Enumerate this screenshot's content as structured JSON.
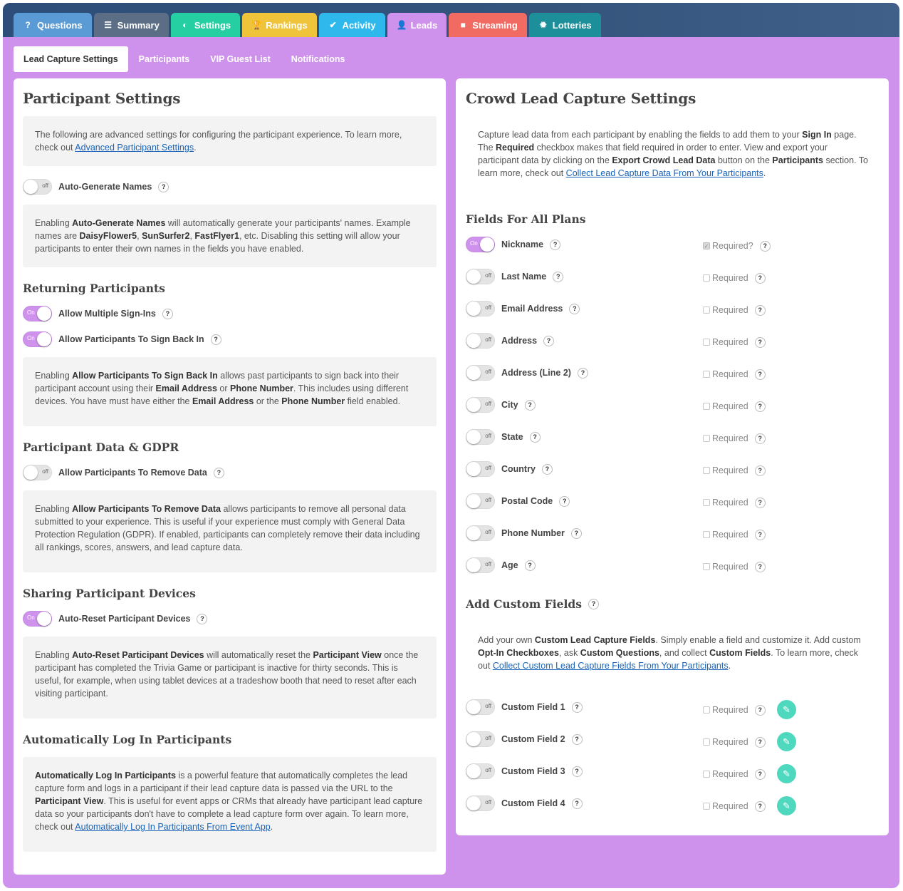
{
  "main_tabs": [
    {
      "label": "Questions",
      "icon": "question-icon",
      "glyph": "?",
      "color": "#5b9bd5"
    },
    {
      "label": "Summary",
      "icon": "list-icon",
      "glyph": "☰",
      "color": "#5b6e86"
    },
    {
      "label": "Settings",
      "icon": "toggle-icon",
      "glyph": "◐",
      "color": "#26cfa2"
    },
    {
      "label": "Rankings",
      "icon": "trophy-icon",
      "glyph": "🏆",
      "color": "#f0c43a"
    },
    {
      "label": "Activity",
      "icon": "check-circle-icon",
      "glyph": "✔",
      "color": "#2eb8ec"
    },
    {
      "label": "Leads",
      "icon": "user-icon",
      "glyph": "👤",
      "color": "#cf92ec"
    },
    {
      "label": "Streaming",
      "icon": "video-icon",
      "glyph": "■",
      "color": "#f26b63"
    },
    {
      "label": "Lotteries",
      "icon": "gear-icon",
      "glyph": "✹",
      "color": "#1d8f9a"
    }
  ],
  "sub_tabs": [
    "Lead Capture Settings",
    "Participants",
    "VIP Guest List",
    "Notifications"
  ],
  "left": {
    "title": "Participant Settings",
    "intro": {
      "text": "The following are advanced settings for configuring the participant experience. To learn more, check out ",
      "link": "Advanced Participant Settings",
      "end": "."
    },
    "auto_generate": {
      "label": "Auto-Generate Names",
      "state": "off"
    },
    "auto_generate_note": {
      "p1": "Enabling ",
      "b1": "Auto-Generate Names",
      "p2": " will automatically generate your participants' names. Example names are ",
      "b2": "DaisyFlower5",
      "p3": ", ",
      "b3": "SunSurfer2",
      "p4": ", ",
      "b4": "FastFlyer1",
      "p5": ", etc. Disabling this setting will allow your participants to enter their own names in the fields you have enabled."
    },
    "returning_title": "Returning Participants",
    "multiple_signins": {
      "label": "Allow Multiple Sign-Ins",
      "state": "On"
    },
    "sign_back_in": {
      "label": "Allow Participants To Sign Back In",
      "state": "On"
    },
    "sign_back_note": {
      "p1": "Enabling ",
      "b1": "Allow Participants To Sign Back In",
      "p2": " allows past participants to sign back into their participant account using their ",
      "b2": "Email Address",
      "p3": " or ",
      "b3": "Phone Number",
      "p4": ". This includes using different devices. You have must have either the ",
      "b4": "Email Address",
      "p5": " or the ",
      "b5": "Phone Number",
      "p6": " field enabled."
    },
    "gdpr_title": "Participant Data & GDPR",
    "remove_data": {
      "label": "Allow Participants To Remove Data",
      "state": "off"
    },
    "remove_note": {
      "p1": "Enabling ",
      "b1": "Allow Participants To Remove Data",
      "p2": " allows participants to remove all personal data submitted to your experience. This is useful if your experience must comply with General Data Protection Regulation (GDPR). If enabled, participants can completely remove their data including all rankings, scores, answers, and lead capture data."
    },
    "sharing_title": "Sharing Participant Devices",
    "auto_reset": {
      "label": "Auto-Reset Participant Devices",
      "state": "On"
    },
    "reset_note": {
      "p1": "Enabling ",
      "b1": "Auto-Reset Participant Devices",
      "p2": " will automatically reset the ",
      "b2": "Participant View",
      "p3": " once the participant has completed the Trivia Game or participant is inactive for thirty seconds. This is useful, for example, when using tablet devices at a tradeshow booth that need to reset after each visiting participant."
    },
    "autologin_title": "Automatically Log In Participants",
    "autologin_note": {
      "b1": "Automatically Log In Participants",
      "p1": " is a powerful feature that automatically completes the lead capture form and logs in a participant if their lead capture data is passed via the URL to the ",
      "b2": "Participant View",
      "p2": ". This is useful for event apps or CRMs that already have participant lead capture data so your participants don't have to complete a lead capture form over again. To learn more, check out ",
      "link": "Automatically Log In Participants From Event App",
      "end": "."
    }
  },
  "right": {
    "title": "Crowd Lead Capture Settings",
    "intro": {
      "p1": "Capture lead data from each participant by enabling the fields to add them to your ",
      "b1": "Sign In",
      "p2": " page. The ",
      "b2": "Required",
      "p3": " checkbox makes that field required in order to enter. View and export your participant data by clicking on the ",
      "b3": "Export Crowd Lead Data",
      "p4": " button on the ",
      "b4": "Participants",
      "p5": " section. To learn more, check out ",
      "link": "Collect Lead Capture Data From Your Participants",
      "end": "."
    },
    "fields_title": "Fields For All Plans",
    "fields": [
      {
        "label": "Nickname",
        "state": "On",
        "required": "Required?",
        "checked": true
      },
      {
        "label": "Last Name",
        "state": "off",
        "required": "Required",
        "checked": false
      },
      {
        "label": "Email Address",
        "state": "off",
        "required": "Required",
        "checked": false
      },
      {
        "label": "Address",
        "state": "off",
        "required": "Required",
        "checked": false
      },
      {
        "label": "Address (Line 2)",
        "state": "off",
        "required": "Required",
        "checked": false
      },
      {
        "label": "City",
        "state": "off",
        "required": "Required",
        "checked": false
      },
      {
        "label": "State",
        "state": "off",
        "required": "Required",
        "checked": false
      },
      {
        "label": "Country",
        "state": "off",
        "required": "Required",
        "checked": false
      },
      {
        "label": "Postal Code",
        "state": "off",
        "required": "Required",
        "checked": false
      },
      {
        "label": "Phone Number",
        "state": "off",
        "required": "Required",
        "checked": false
      },
      {
        "label": "Age",
        "state": "off",
        "required": "Required",
        "checked": false
      }
    ],
    "custom_title": "Add Custom Fields",
    "custom_intro": {
      "p1": "Add your own ",
      "b1": "Custom Lead Capture Fields",
      "p2": ". Simply enable a field and customize it. Add custom ",
      "b2": "Opt-In Checkboxes",
      "p3": ", ask ",
      "b3": "Custom Questions",
      "p4": ", and collect ",
      "b4": "Custom Fields",
      "p5": ". To learn more, check out ",
      "link": "Collect Custom Lead Capture Fields From Your Participants",
      "end": "."
    },
    "custom_fields": [
      {
        "label": "Custom Field 1",
        "state": "off",
        "required": "Required"
      },
      {
        "label": "Custom Field 2",
        "state": "off",
        "required": "Required"
      },
      {
        "label": "Custom Field 3",
        "state": "off",
        "required": "Required"
      },
      {
        "label": "Custom Field 4",
        "state": "off",
        "required": "Required"
      }
    ]
  },
  "help_glyph": "?",
  "edit_glyph": "✎"
}
